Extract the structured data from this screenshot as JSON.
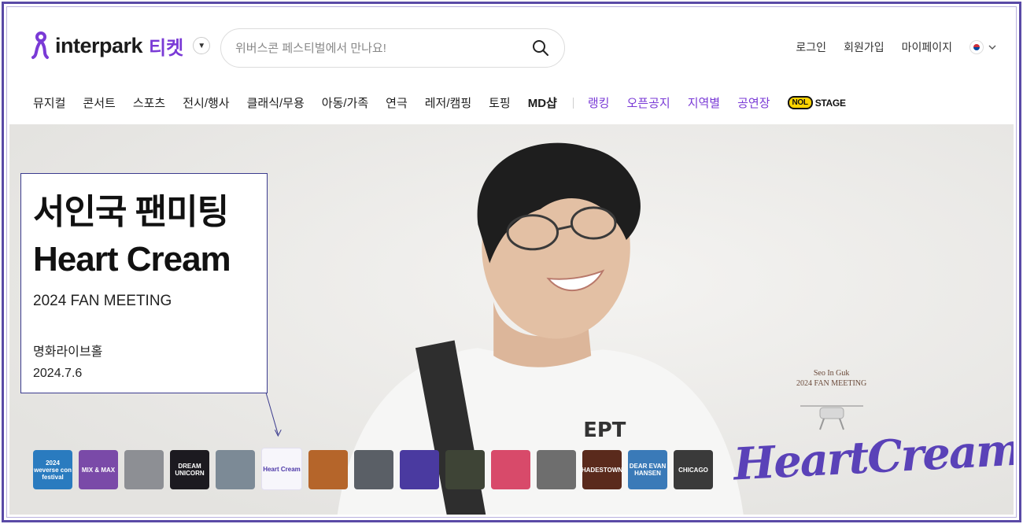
{
  "header": {
    "logo_text": "interpark",
    "logo_ticket": "티켓",
    "search_placeholder": "위버스콘 페스티벌에서 만나요!",
    "util": {
      "login": "로그인",
      "signup": "회원가입",
      "mypage": "마이페이지"
    }
  },
  "nav": {
    "items": [
      "뮤지컬",
      "콘서트",
      "스포츠",
      "전시/행사",
      "클래식/무용",
      "아동/가족",
      "연극",
      "레저/캠핑",
      "토핑",
      "MD샵"
    ],
    "special": [
      "랭킹",
      "오픈공지",
      "지역별",
      "공연장"
    ],
    "nol_stage": "STAGE",
    "nol_badge": "NOL"
  },
  "hero": {
    "title_line1": "서인국 팬미팅",
    "title_line2": "Heart Cream",
    "subtitle": "2024 FAN MEETING",
    "venue": "명화라이브홀",
    "date": "2024.7.6",
    "poster_caption_1": "Seo In Guk",
    "poster_caption_2": "2024 FAN MEETING",
    "brand_title": "HeartCream"
  },
  "thumbnails": [
    {
      "label": "2024 weverse con festival",
      "color": "#2a7bbf"
    },
    {
      "label": "MIX & MAX",
      "color": "#7a4aa8"
    },
    {
      "label": "",
      "color": "#8d8f94"
    },
    {
      "label": "DREAM UNICORN",
      "color": "#1c1a20"
    },
    {
      "label": "",
      "color": "#7c8a96"
    },
    {
      "label": "Heart Cream",
      "color": "#f7f6fb"
    },
    {
      "label": "",
      "color": "#b5652a"
    },
    {
      "label": "",
      "color": "#5a5f66"
    },
    {
      "label": "",
      "color": "#4a3aa0"
    },
    {
      "label": "",
      "color": "#3e4436"
    },
    {
      "label": "",
      "color": "#d84a6a"
    },
    {
      "label": "",
      "color": "#6e6e6e"
    },
    {
      "label": "HADESTOWN",
      "color": "#5a2a1c"
    },
    {
      "label": "DEAR EVAN HANSEN",
      "color": "#3a7ab8"
    },
    {
      "label": "CHICAGO",
      "color": "#3a3a3a"
    }
  ],
  "colors": {
    "accent": "#7a3ad6",
    "frame": "#5a4aa6",
    "brand": "#5a42b8"
  }
}
